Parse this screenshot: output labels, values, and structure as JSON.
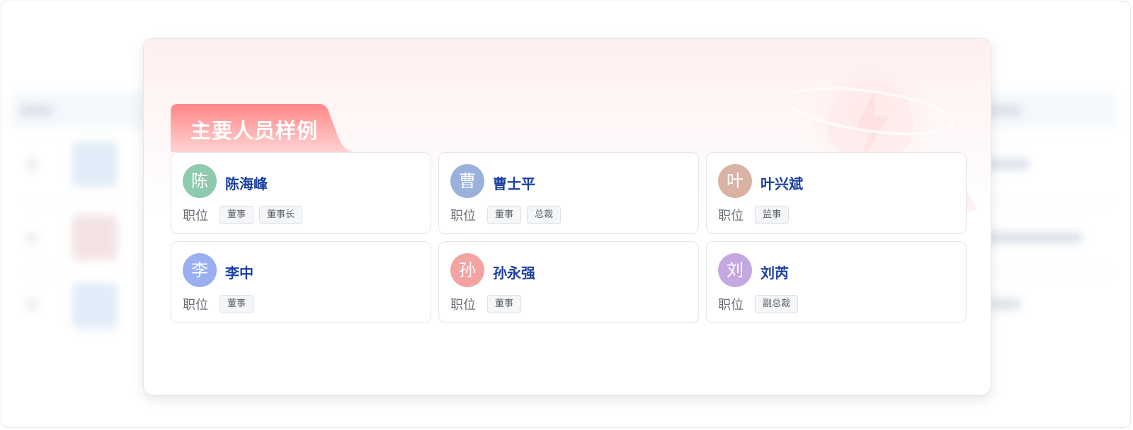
{
  "modal": {
    "title": "主要人员样例",
    "position_label": "职位",
    "people": [
      {
        "avatar_char": "陈",
        "name": "陈海峰",
        "avatar_color": "#8ecab0",
        "positions": [
          "董事",
          "董事长"
        ]
      },
      {
        "avatar_char": "曹",
        "name": "曹士平",
        "avatar_color": "#99b1db",
        "positions": [
          "董事",
          "总裁"
        ]
      },
      {
        "avatar_char": "叶",
        "name": "叶兴斌",
        "avatar_color": "#d9b2a4",
        "positions": [
          "监事"
        ]
      },
      {
        "avatar_char": "李",
        "name": "李中",
        "avatar_color": "#9aaef2",
        "positions": [
          "董事"
        ]
      },
      {
        "avatar_char": "孙",
        "name": "孙永强",
        "avatar_color": "#f4a3a3",
        "positions": [
          "董事"
        ]
      },
      {
        "avatar_char": "刘",
        "name": "刘芮",
        "avatar_color": "#c4a9e0",
        "positions": [
          "副总裁"
        ]
      }
    ]
  },
  "colors": {
    "accent_gradient_start": "#ff8a8a",
    "accent_gradient_end": "#ffd3d3",
    "name_text": "#1a3fa0"
  }
}
